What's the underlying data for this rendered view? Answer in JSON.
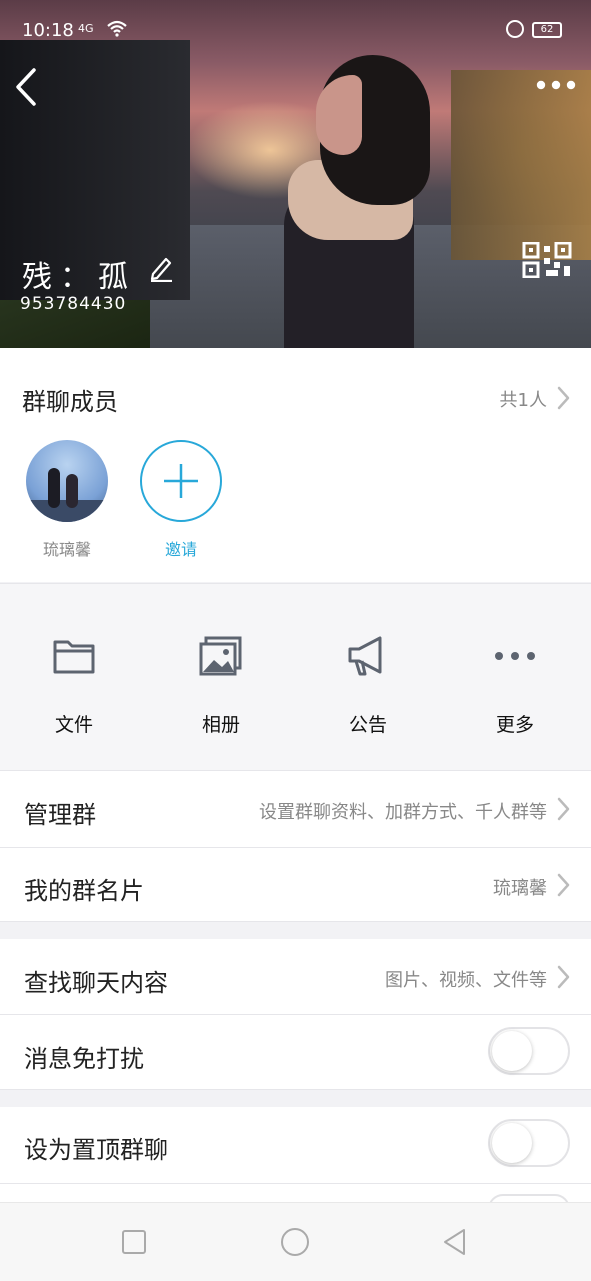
{
  "status_bar": {
    "time": "10:18",
    "signal": "4G",
    "battery": "62"
  },
  "header": {
    "group_name": "残：孤",
    "group_id": "953784430"
  },
  "members": {
    "title": "群聊成员",
    "count_text": "共1人",
    "list": [
      {
        "name": "琉璃馨"
      }
    ],
    "invite_label": "邀请"
  },
  "features": [
    {
      "label": "文件",
      "icon": "folder-icon"
    },
    {
      "label": "相册",
      "icon": "album-icon"
    },
    {
      "label": "公告",
      "icon": "announcement-icon"
    },
    {
      "label": "更多",
      "icon": "more-dots-icon"
    }
  ],
  "settings": {
    "manage": {
      "title": "管理群",
      "value": "设置群聊资料、加群方式、千人群等"
    },
    "card": {
      "title": "我的群名片",
      "value": "琉璃馨"
    },
    "search": {
      "title": "查找聊天内容",
      "value": "图片、视频、文件等"
    },
    "mute": {
      "title": "消息免打扰",
      "on": false
    },
    "pin": {
      "title": "设为置顶群聊",
      "on": false
    }
  },
  "colors": {
    "accent": "#28a8d9",
    "secondary_text": "#888888"
  }
}
